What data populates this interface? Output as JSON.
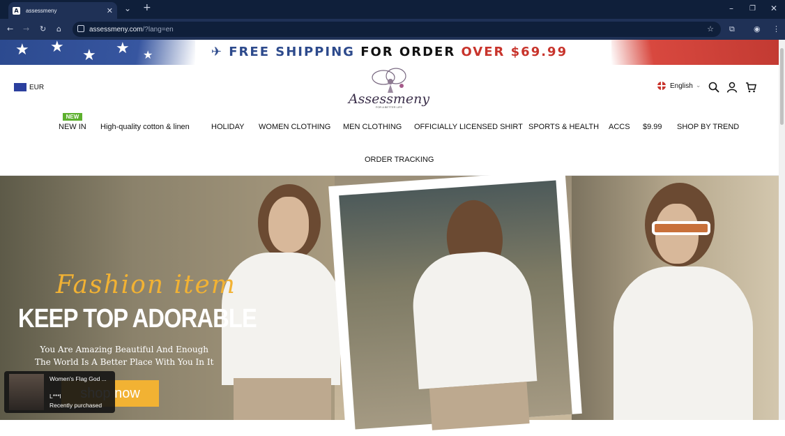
{
  "browser": {
    "tab_title": "assessmeny",
    "tab_favicon_letter": "A",
    "url_host": "assessmeny.com",
    "url_query": "/?lang=en"
  },
  "banner": {
    "text_part1": "FREE SHIPPING",
    "text_part2": "FOR ORDER",
    "text_part3": "OVER $69.99"
  },
  "header": {
    "currency": "EUR",
    "logo_text": "Assessmeny",
    "logo_tagline": "FOR A BETTER LIFE",
    "language": "English"
  },
  "menu": {
    "new_badge": "NEW",
    "items": [
      "NEW IN",
      "High-quality cotton & linen",
      "HOLIDAY",
      "WOMEN CLOTHING",
      "MEN CLOTHING",
      "OFFICIALLY LICENSED SHIRT",
      "SPORTS & HEALTH",
      "ACCS",
      "$9.99",
      "SHOP BY TREND",
      "ORDER TRACKING"
    ]
  },
  "hero": {
    "script_title": "Fashion item",
    "headline": "KEEP TOP ADORABLE",
    "sub_line1": "You Are Amazing Beautiful And Enough",
    "sub_line2": "The World Is A Better Place With You In It",
    "cta": "shop now"
  },
  "popup": {
    "product_name": "Women's Flag God ...",
    "user": "L***l",
    "status": "Recently purchased"
  },
  "colors": {
    "accent": "#f2b233",
    "banner_blue": "#2d4a8c",
    "banner_red": "#c8342c",
    "new_badge": "#5db02e"
  }
}
